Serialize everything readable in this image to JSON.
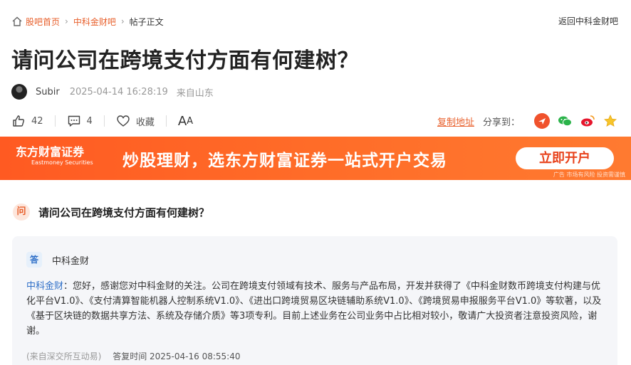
{
  "breadcrumb": {
    "home": "股吧首页",
    "board": "中科金财吧",
    "current": "帖子正文",
    "back": "返回中科金财吧"
  },
  "post": {
    "title": "请问公司在跨境支付方面有何建树？",
    "author": "Subir",
    "time": "2025-04-14 16:28:19",
    "location": "来自山东",
    "likes": "42",
    "comments": "4",
    "favorite": "收藏",
    "font_large": "A",
    "font_small": "A"
  },
  "share": {
    "copy": "复制地址",
    "label": "分享到：",
    "icons": [
      "weibo-app-icon",
      "wechat-icon",
      "sina-weibo-icon",
      "star-icon"
    ]
  },
  "banner": {
    "logo": "东方财富证券",
    "logo_en": "Eastmoney Securities",
    "slogan": "炒股理财，选东方财富证券一站式开户交易",
    "button": "立即开户",
    "ad_note": "广告 市场有风险 投资需谨慎"
  },
  "question": {
    "badge": "问",
    "text": "请问公司在跨境支付方面有何建树？"
  },
  "answer": {
    "badge": "答",
    "company": "中科金财",
    "who": "中科金财",
    "text": "：您好，感谢您对中科金财的关注。公司在跨境支付领域有技术、服务与产品布局，开发并获得了《中科金财数币跨境支付构建与优化平台V1.0》、《支付清算智能机器人控制系统V1.0》、《进出口跨境贸易区块链辅助系统V1.0》、《跨境贸易申报服务平台V1.0》等软著，以及《基于区块链的数据共享方法、系统及存储介质》等3项专利。目前上述业务在公司业务中占比相对较小，敬请广大投资者注意投资风险，谢谢。",
    "source": "(来自深交所互动易)",
    "reply_time": "答复时间 2025-04-16 08:55:40"
  },
  "colors": {
    "accent": "#e8602c",
    "banner": "#ff5a22",
    "answer_blue": "#2d6ec7"
  }
}
